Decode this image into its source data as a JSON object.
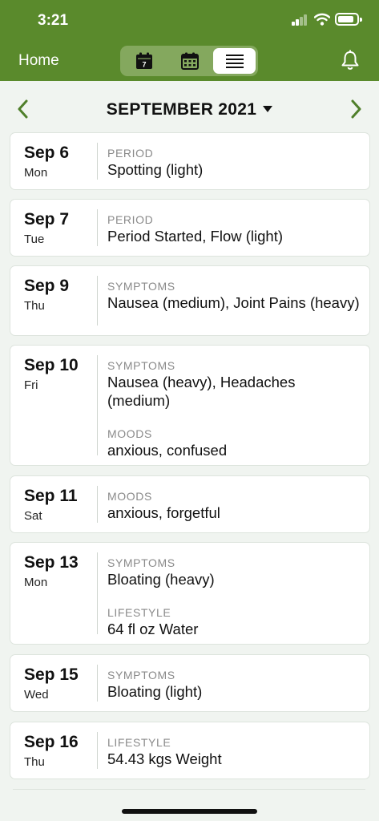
{
  "status": {
    "time": "3:21"
  },
  "nav": {
    "home_label": "Home",
    "calendar_day_number": "7"
  },
  "month": {
    "title": "SEPTEMBER 2021"
  },
  "colors": {
    "brand_green": "#5a8a2c",
    "segment_bg": "#84a85e",
    "arrow_green": "#4f7f2a"
  },
  "icons": {
    "calendar_day": "calendar-day-icon",
    "calendar_month": "calendar-month-icon",
    "list": "list-icon",
    "bell": "bell-icon",
    "prev": "chevron-left-icon",
    "next": "chevron-right-icon"
  },
  "entries": [
    {
      "day": "Sep 6",
      "weekday": "Mon",
      "sections": [
        {
          "title": "PERIOD",
          "text": "Spotting (light)"
        }
      ]
    },
    {
      "day": "Sep 7",
      "weekday": "Tue",
      "sections": [
        {
          "title": "PERIOD",
          "text": "Period Started, Flow (light)"
        }
      ]
    },
    {
      "day": "Sep 9",
      "weekday": "Thu",
      "sections": [
        {
          "title": "SYMPTOMS",
          "text": "Nausea (medium), Joint Pains (heavy)"
        }
      ]
    },
    {
      "day": "Sep 10",
      "weekday": "Fri",
      "sections": [
        {
          "title": "SYMPTOMS",
          "text": "Nausea (heavy), Headaches (medium)"
        },
        {
          "title": "MOODS",
          "text": "anxious, confused"
        }
      ]
    },
    {
      "day": "Sep 11",
      "weekday": "Sat",
      "sections": [
        {
          "title": "MOODS",
          "text": "anxious, forgetful"
        }
      ]
    },
    {
      "day": "Sep 13",
      "weekday": "Mon",
      "sections": [
        {
          "title": "SYMPTOMS",
          "text": "Bloating (heavy)"
        },
        {
          "title": "LIFESTYLE",
          "text": "64 fl oz Water"
        }
      ]
    },
    {
      "day": "Sep 15",
      "weekday": "Wed",
      "sections": [
        {
          "title": "SYMPTOMS",
          "text": "Bloating (light)"
        }
      ]
    },
    {
      "day": "Sep 16",
      "weekday": "Thu",
      "sections": [
        {
          "title": "LIFESTYLE",
          "text": "54.43 kgs Weight"
        }
      ]
    }
  ]
}
